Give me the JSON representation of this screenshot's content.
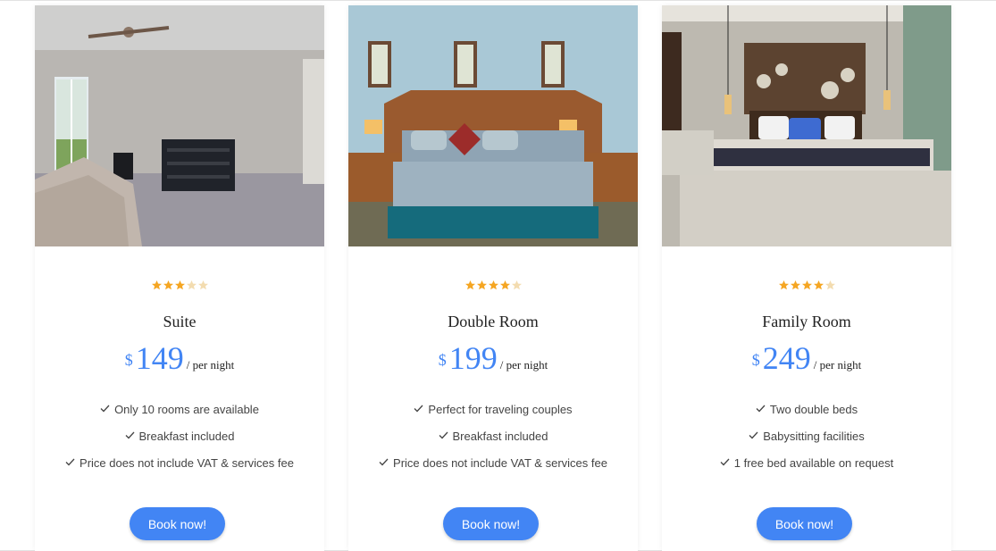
{
  "colors": {
    "accent": "#4285f4",
    "star_filled": "#f5a623",
    "star_empty": "#f3dcb0"
  },
  "rooms": [
    {
      "name": "Suite",
      "currency": "$",
      "price": "149",
      "per_night": "/ per night",
      "rating": 3,
      "rating_max": 5,
      "features": [
        "Only 10 rooms are available",
        "Breakfast included",
        "Price does not include VAT & services fee"
      ],
      "book_label": "Book now!"
    },
    {
      "name": "Double Room",
      "currency": "$",
      "price": "199",
      "per_night": "/ per night",
      "rating": 4,
      "rating_max": 5,
      "features": [
        "Perfect for traveling couples",
        "Breakfast included",
        "Price does not include VAT & services fee"
      ],
      "book_label": "Book now!"
    },
    {
      "name": "Family Room",
      "currency": "$",
      "price": "249",
      "per_night": "/ per night",
      "rating": 4,
      "rating_max": 5,
      "features": [
        "Two double beds",
        "Babysitting facilities",
        "1 free bed available on request"
      ],
      "book_label": "Book now!"
    }
  ]
}
